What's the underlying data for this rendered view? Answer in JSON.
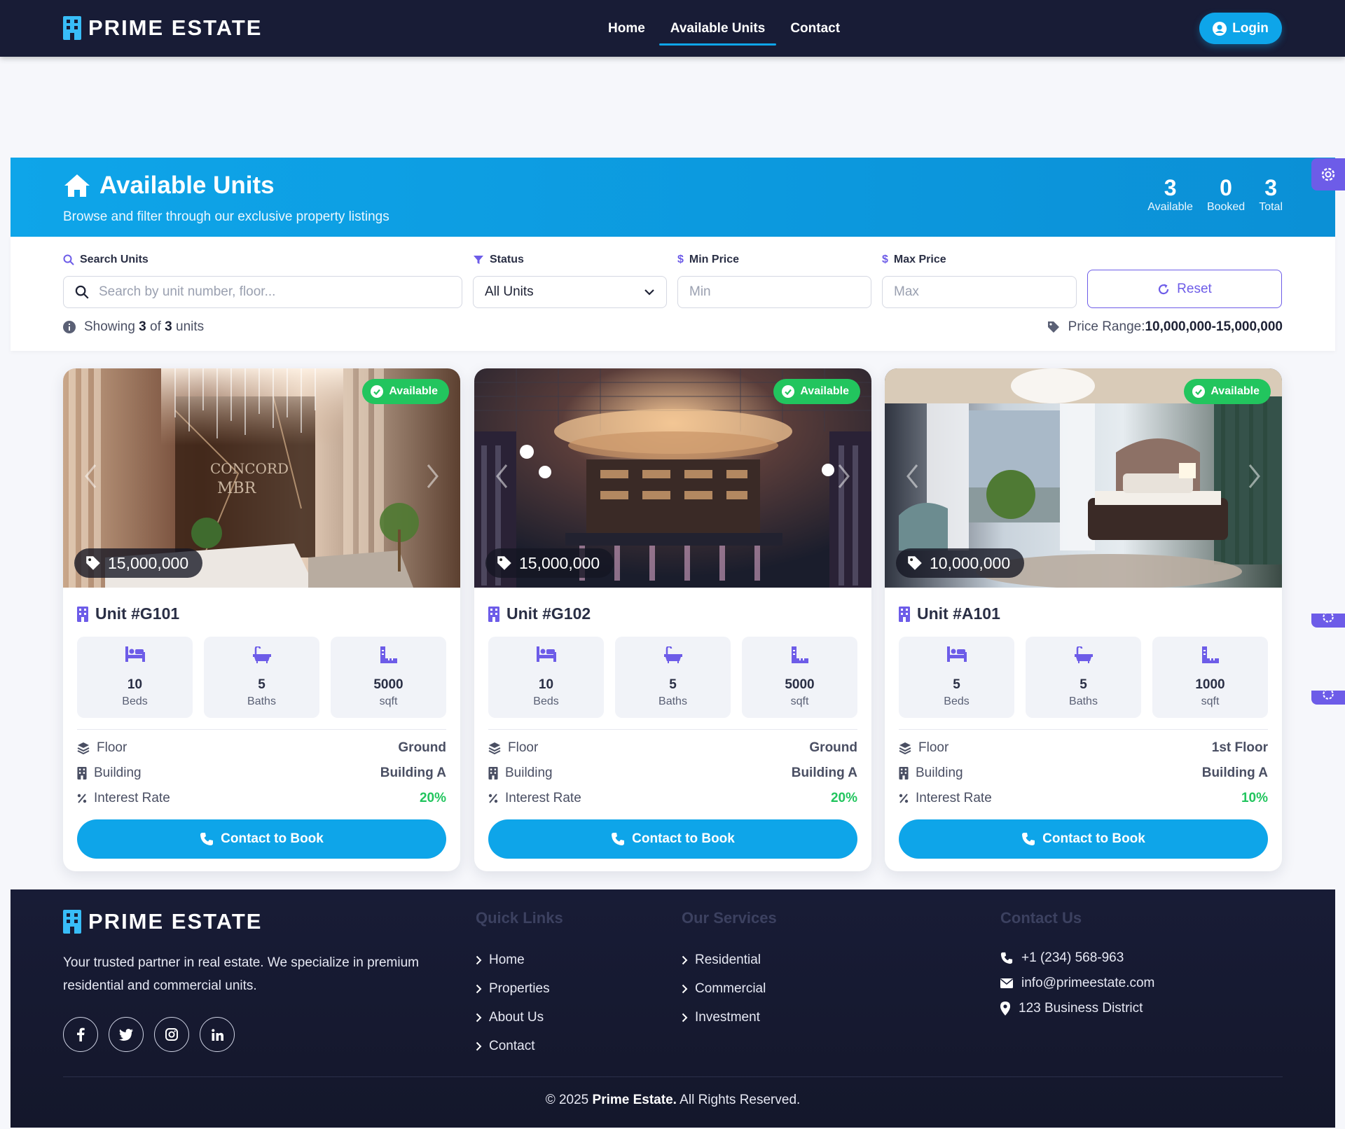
{
  "brand": {
    "name": "PRIME ESTATE"
  },
  "nav": {
    "home": "Home",
    "available": "Available Units",
    "contact": "Contact",
    "login": "Login"
  },
  "hero": {
    "title": "Available Units",
    "subtitle": "Browse and filter through our exclusive property listings",
    "stats": [
      {
        "value": "3",
        "label": "Available"
      },
      {
        "value": "0",
        "label": "Booked"
      },
      {
        "value": "3",
        "label": "Total"
      }
    ]
  },
  "filters": {
    "search_label": "Search Units",
    "search_placeholder": "Search by unit number, floor...",
    "status_label": "Status",
    "status_value": "All Units",
    "min_label": "Min Price",
    "min_placeholder": "Min",
    "max_label": "Max Price",
    "max_placeholder": "Max",
    "reset": "Reset",
    "showing_prefix": "Showing",
    "showing_count": "3",
    "showing_of": "of",
    "showing_total": "3",
    "showing_suffix": "units",
    "price_range_label": "Price Range:",
    "price_range_min": "10,000,000",
    "price_range_sep": "-",
    "price_range_max": "15,000,000"
  },
  "labels": {
    "floor": "Floor",
    "building": "Building",
    "interest": "Interest Rate",
    "book": "Contact to Book",
    "beds": "Beds",
    "baths": "Baths",
    "sqft": "sqft"
  },
  "units": [
    {
      "status": "Available",
      "price": "15,000,000",
      "title": "Unit #G101",
      "beds": "10",
      "baths": "5",
      "sqft": "5000",
      "floor": "Ground",
      "building": "Building A",
      "interest": "20%"
    },
    {
      "status": "Available",
      "price": "15,000,000",
      "title": "Unit #G102",
      "beds": "10",
      "baths": "5",
      "sqft": "5000",
      "floor": "Ground",
      "building": "Building A",
      "interest": "20%"
    },
    {
      "status": "Available",
      "price": "10,000,000",
      "title": "Unit #A101",
      "beds": "5",
      "baths": "5",
      "sqft": "1000",
      "floor": "1st Floor",
      "building": "Building A",
      "interest": "10%"
    }
  ],
  "footer": {
    "about": "Your trusted partner in real estate. We specialize in premium residential and commercial units.",
    "quick_title": "Quick Links",
    "quick": [
      "Home",
      "Properties",
      "About Us",
      "Contact"
    ],
    "services_title": "Our Services",
    "services": [
      "Residential",
      "Commercial",
      "Investment"
    ],
    "contact_title": "Contact Us",
    "phone": "+1 (234) 568-963",
    "email": "info@primeestate.com",
    "address": "123 Business District",
    "copy_prefix": "© 2025",
    "copy_brand": "Prime Estate.",
    "copy_suffix": "All Rights Reserved."
  },
  "colors": {
    "primary": "#0ea5e9",
    "accent": "#6d5ce8",
    "success": "#22c55e",
    "navy": "#181c36"
  }
}
